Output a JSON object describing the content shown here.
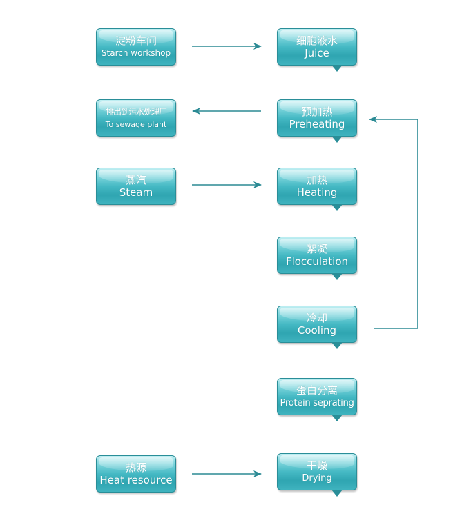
{
  "colors": {
    "box": "#3fb3be",
    "line": "#2b8a94",
    "text": "#ffffff"
  },
  "left": [
    {
      "cn": "淀粉车间",
      "en": "Starch workshop"
    },
    {
      "cn": "排出到污水处理厂",
      "en": "To sewage plant"
    },
    {
      "cn": "蒸汽",
      "en": "Steam"
    },
    {
      "cn": "热源",
      "en": "Heat resource"
    }
  ],
  "right": [
    {
      "cn": "细胞液水",
      "en": "Juice"
    },
    {
      "cn": "预加热",
      "en": "Preheating"
    },
    {
      "cn": "加热",
      "en": "Heating"
    },
    {
      "cn": "絮凝",
      "en": "Flocculation"
    },
    {
      "cn": "冷却",
      "en": "Cooling"
    },
    {
      "cn": "蛋白分离",
      "en": "Protein seprating"
    },
    {
      "cn": "干燥",
      "en": "Drying"
    }
  ]
}
